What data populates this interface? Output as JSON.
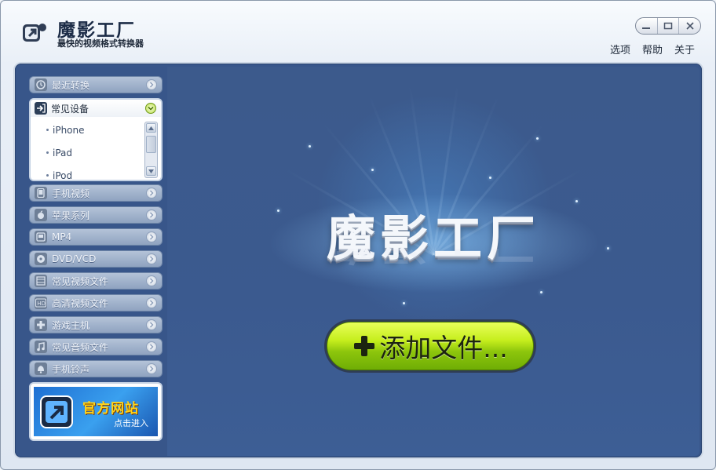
{
  "app": {
    "title": "魔影工厂",
    "subtitle": "最快的视频格式转换器",
    "logo_icon": "camera-convert-icon"
  },
  "window_controls": {
    "minimize": "minimize-icon",
    "maximize": "maximize-icon",
    "close": "close-icon"
  },
  "menu": {
    "items": [
      "选项",
      "帮助",
      "关于"
    ]
  },
  "sidebar": {
    "recent": {
      "label": "最近转换",
      "icon": "clock-icon"
    },
    "common_devices": {
      "label": "常见设备",
      "icon": "arrow-in-icon",
      "expanded": true,
      "items": [
        "iPhone",
        "iPad",
        "iPod"
      ]
    },
    "categories": [
      {
        "label": "手机视频",
        "icon": "phone-icon"
      },
      {
        "label": "苹果系列",
        "icon": "apple-icon"
      },
      {
        "label": "MP4",
        "icon": "mp4-player-icon"
      },
      {
        "label": "DVD/VCD",
        "icon": "disc-icon"
      },
      {
        "label": "常见视频文件",
        "icon": "film-icon"
      },
      {
        "label": "高清视频文件",
        "icon": "hd-icon"
      },
      {
        "label": "游戏主机",
        "icon": "gamepad-icon"
      },
      {
        "label": "常见音频文件",
        "icon": "music-note-icon"
      },
      {
        "label": "手机铃声",
        "icon": "bell-icon"
      }
    ],
    "promo": {
      "title": "官方网站",
      "subtitle": "点击进入"
    }
  },
  "stage": {
    "brand": "魔影工厂",
    "add_button": {
      "label": "添加文件...",
      "icon": "plus-icon"
    }
  },
  "colors": {
    "stage_bg": "#3b5a8f",
    "sidebar_category": "#9fb1cb",
    "add_button_green": "#c6ee1d",
    "promo_title": "#ffd31a"
  }
}
